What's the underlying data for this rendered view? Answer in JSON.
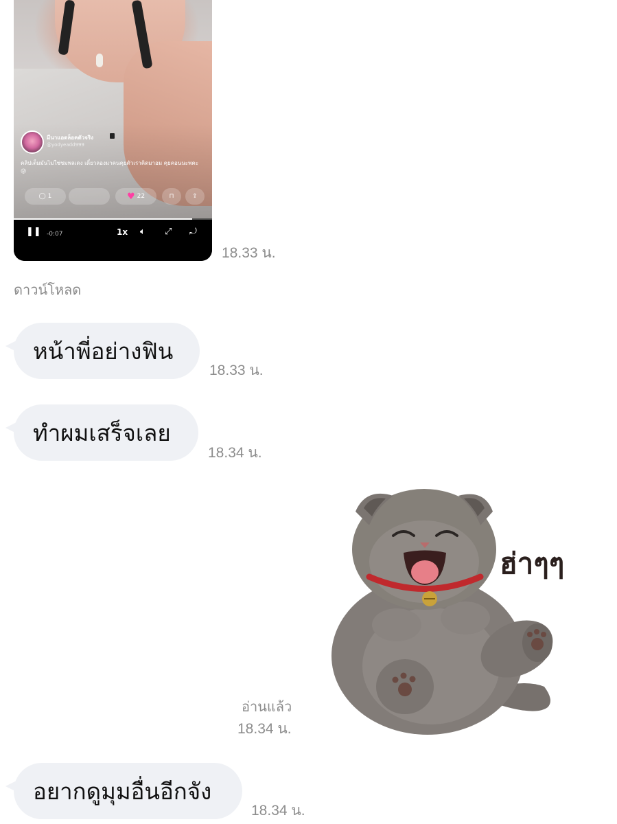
{
  "video_message": {
    "user_name": "มีนาแอดล็อคตัวจริง",
    "user_handle": "@yodyeadd999",
    "caption": "คลิปเต็มมันไม่ใช่ชมพลเดง เดี๋ยวลองมาคนคุยตัวเราคิดมาอม คุยคอนนะพคะ😜",
    "comment_count": "1",
    "like_count": "22",
    "elapsed_time": "-0:07",
    "speed": "1x",
    "progress_fraction": 0.9,
    "timestamp": "18.33 น."
  },
  "download_label": "ดาวน์โหลด",
  "messages": [
    {
      "text": "หน้าพี่อย่างฟิน",
      "timestamp": "18.33 น."
    },
    {
      "text": "ทำผมเสร็จเลย",
      "timestamp": "18.34 น."
    }
  ],
  "sticker": {
    "text": "ฮ่าๆๆ",
    "read_label": "อ่านแล้ว",
    "timestamp": "18.34 น."
  },
  "last_message": {
    "text": "อยากดูมุมอื่นอีกจัง",
    "timestamp": "18.34 น."
  },
  "colors": {
    "bubble_bg": "#eff1f5",
    "timestamp": "#8c8c8c",
    "heart": "#ff3fa4",
    "cat_fur": "#7d7773",
    "collar": "#c0292d"
  }
}
